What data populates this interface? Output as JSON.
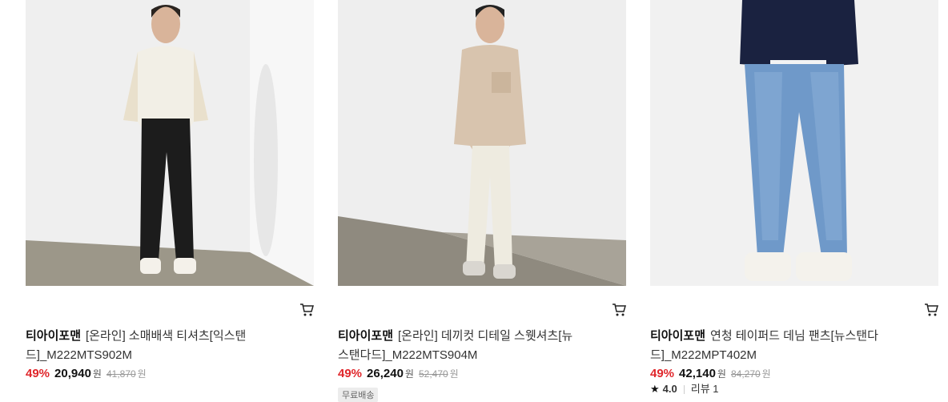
{
  "products": [
    {
      "brand": "티아이포맨",
      "name": "[온라인] 소매배색 티셔츠[익스탠드]_M222MTS902M",
      "discount": "49%",
      "price": "20,940",
      "currency": "원",
      "original_price": "41,870",
      "original_currency": "원",
      "cart_icon": "shopping-cart-icon",
      "colors": {
        "top": "#f2efe6",
        "sleeve": "#e9e0cc",
        "pants": "#1c1c1c"
      }
    },
    {
      "brand": "티아이포맨",
      "name": "[온라인] 데끼컷 디테일 스웻셔츠[뉴스탠다드]_M222MTS904M",
      "discount": "49%",
      "price": "26,240",
      "currency": "원",
      "original_price": "52,470",
      "original_currency": "원",
      "badge": "무료배송",
      "cart_icon": "shopping-cart-icon",
      "colors": {
        "top": "#d8c4ae",
        "pants": "#eeebe0"
      }
    },
    {
      "brand": "티아이포맨",
      "name": "연청 테이퍼드 데님 팬츠[뉴스탠다드]_M222MPT402M",
      "discount": "49%",
      "price": "42,140",
      "currency": "원",
      "original_price": "84,270",
      "original_currency": "원",
      "rating": "4.0",
      "reviews": "리뷰 1",
      "cart_icon": "shopping-cart-icon",
      "colors": {
        "top": "#1a2240",
        "pants": "#6f99c9"
      }
    }
  ]
}
